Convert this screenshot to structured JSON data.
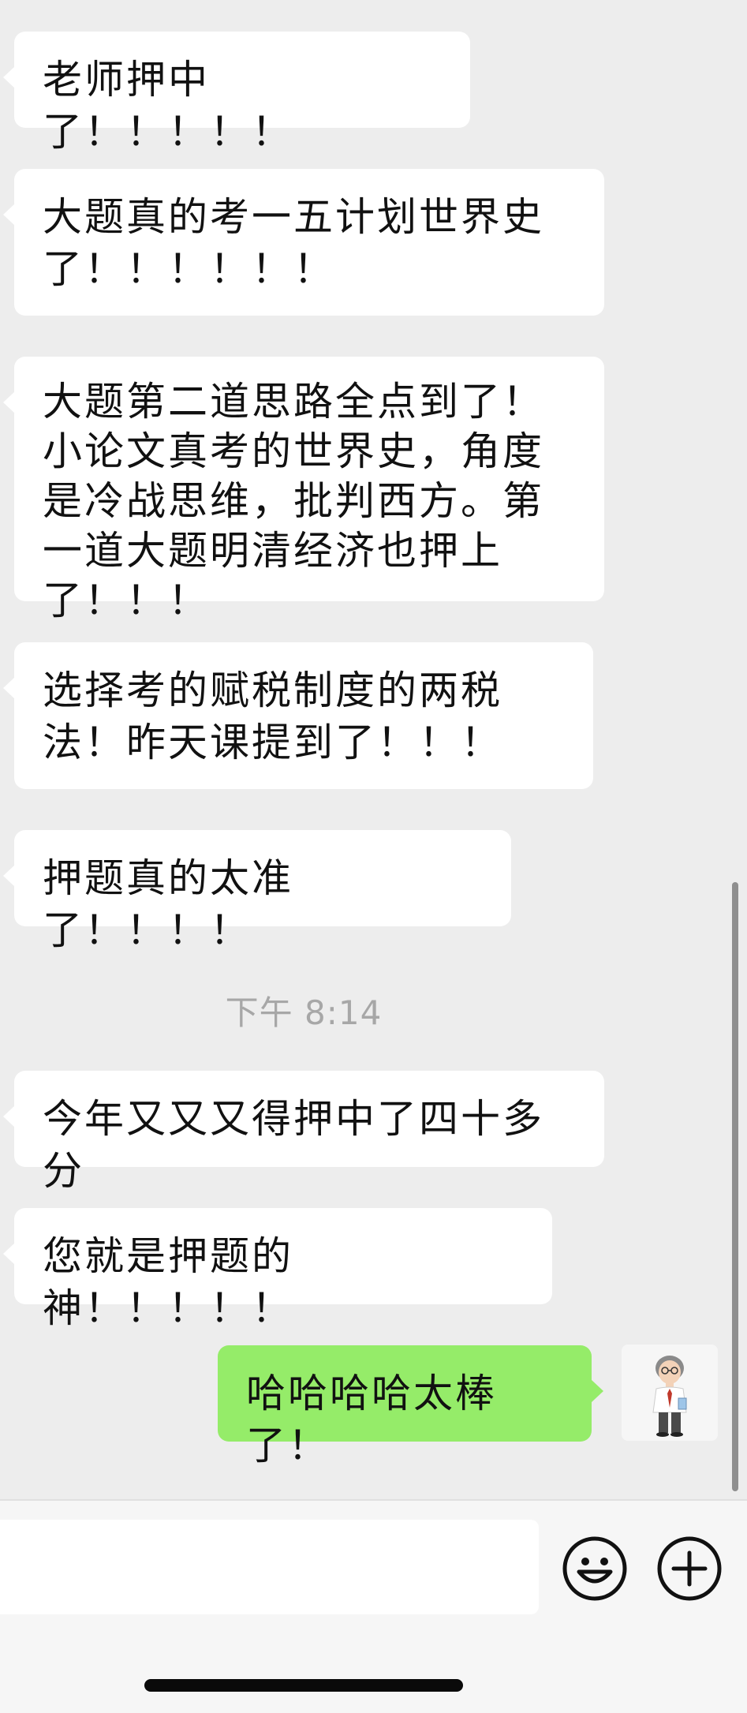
{
  "messages": [
    {
      "text": "老师押中了！！！！！"
    },
    {
      "text": "大题真的考一五计划世界史了！！！！！！"
    },
    {
      "text": "大题第二道思路全点到了！小论文真考的世界史，角度是冷战思维，批判西方。第一道大题明清经济也押上了！！！"
    },
    {
      "text": "选择考的赋税制度的两税法！昨天课提到了！！！"
    },
    {
      "text": "押题真的太准了！！！！"
    },
    {
      "text": "今年又又又得押中了四十多分"
    },
    {
      "text": "您就是押题的神！！！！！"
    },
    {
      "text": "哈哈哈哈太棒了！"
    }
  ],
  "timestamp": "下午 8:14",
  "input": {
    "value": "",
    "placeholder": ""
  },
  "icons": {
    "emoji": "smiley-face",
    "plus": "plus-circle"
  },
  "colors": {
    "background": "#ededed",
    "incoming_bubble": "#ffffff",
    "outgoing_bubble": "#95ec69"
  }
}
